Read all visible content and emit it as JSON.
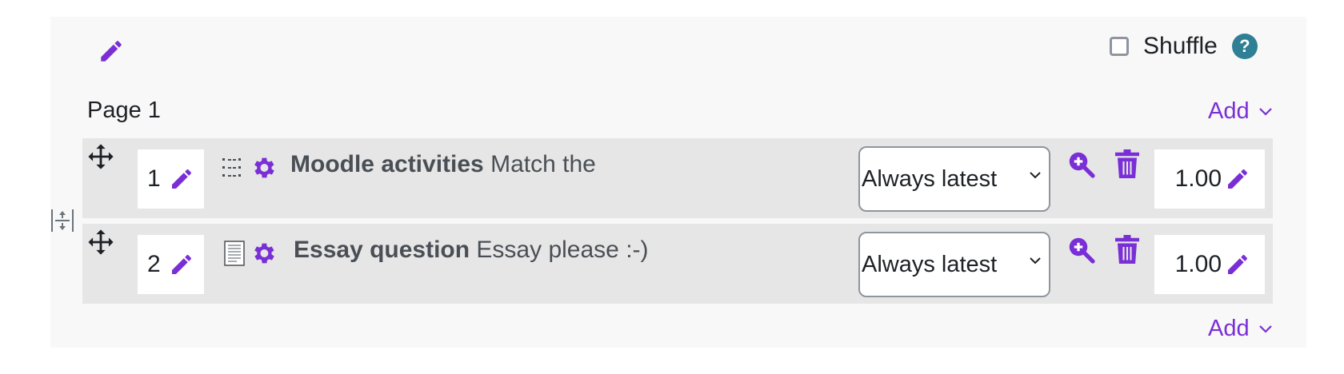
{
  "section": {
    "shuffle_label": "Shuffle",
    "help_glyph": "?",
    "page_title": "Page 1",
    "add_label_top": "Add",
    "add_label_bottom": "Add"
  },
  "slots": [
    {
      "number": "1",
      "type_icon": "matching-question-icon",
      "title": "Moodle activities",
      "text": "Match the",
      "version": "Always latest",
      "mark": "1.00"
    },
    {
      "number": "2",
      "type_icon": "essay-question-icon",
      "title": "Essay question",
      "text": "Essay please :-)",
      "version": "Always latest",
      "mark": "1.00"
    }
  ],
  "colors": {
    "accent": "#7a2fd6",
    "help": "#2f7f95",
    "slot_bg": "#e6e6e6",
    "section_bg": "#f8f8f8"
  }
}
